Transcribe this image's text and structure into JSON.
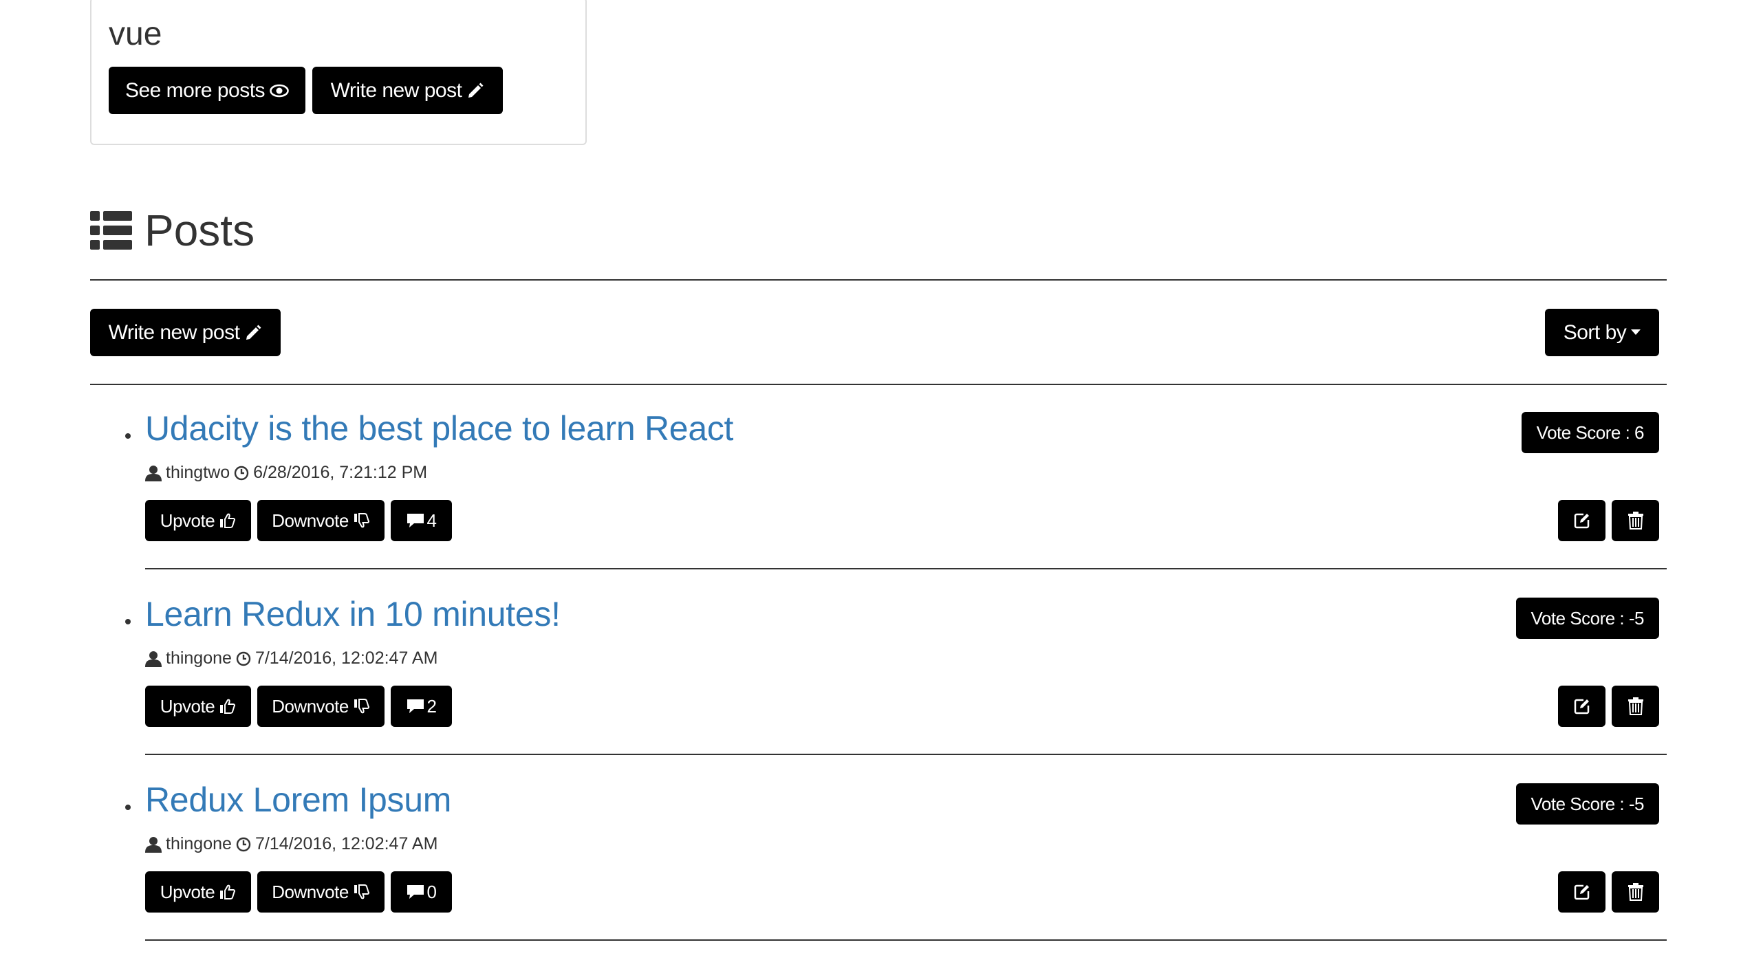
{
  "category": {
    "name": "vue",
    "see_more_label": "See more posts",
    "write_label": "Write new post"
  },
  "posts_section": {
    "title": "Posts",
    "write_label": "Write new post",
    "sort_label": "Sort by"
  },
  "posts": [
    {
      "title": "Udacity is the best place to learn React",
      "author": "thingtwo",
      "timestamp": "6/28/2016, 7:21:12 PM",
      "vote_score": "Vote Score : 6",
      "upvote_label": "Upvote",
      "downvote_label": "Downvote",
      "comment_count": "4"
    },
    {
      "title": "Learn Redux in 10 minutes!",
      "author": "thingone",
      "timestamp": "7/14/2016, 12:02:47 AM",
      "vote_score": "Vote Score : -5",
      "upvote_label": "Upvote",
      "downvote_label": "Downvote",
      "comment_count": "2"
    },
    {
      "title": "Redux Lorem Ipsum",
      "author": "thingone",
      "timestamp": "7/14/2016, 12:02:47 AM",
      "vote_score": "Vote Score : -5",
      "upvote_label": "Upvote",
      "downvote_label": "Downvote",
      "comment_count": "0"
    }
  ],
  "icons": {
    "see_more": "eye-icon",
    "write": "pencil-icon",
    "posts_header": "list-icon",
    "sort": "caret-down-icon",
    "author": "user-icon",
    "time": "clock-icon",
    "upvote": "thumbs-up-icon",
    "downvote": "thumbs-down-icon",
    "comments": "comment-icon",
    "edit": "edit-icon",
    "delete": "trash-icon"
  },
  "colors": {
    "button_bg": "#000000",
    "button_text": "#ffffff",
    "link": "#337ab7",
    "text": "#333333",
    "card_border": "#dddddd"
  }
}
